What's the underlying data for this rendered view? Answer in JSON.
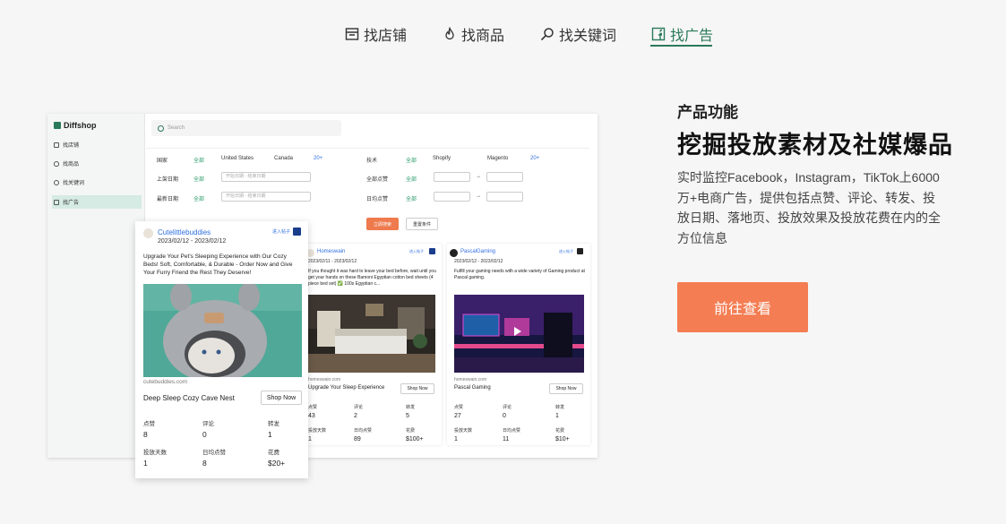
{
  "tabs": [
    {
      "label": "找店铺",
      "icon": "store-icon",
      "active": false
    },
    {
      "label": "找商品",
      "icon": "flame-icon",
      "active": false
    },
    {
      "label": "找关键词",
      "icon": "search-icon",
      "active": false
    },
    {
      "label": "找广告",
      "icon": "facebook-icon",
      "active": true
    }
  ],
  "feature": {
    "label": "产品功能",
    "headline": "挖掘投放素材及社媒爆品",
    "body": "实时监控Facebook，Instagram，TikTok上6000万+电商广告，提供包括点赞、评论、转发、投放日期、落地页、投放效果及投放花费在内的全方位信息",
    "cta": "前往查看"
  },
  "mock": {
    "logo": "Diffshop",
    "sidebar": [
      "找店铺",
      "找商品",
      "找关键词",
      "找广告"
    ],
    "search_placeholder": "Search",
    "filters": {
      "country": "国家",
      "all": "全部",
      "us": "United States",
      "canada": "Canada",
      "more": "20+",
      "tech": "技术",
      "shopify": "Shopify",
      "magento": "Magento",
      "launch_date": "上架日期",
      "latest_date": "最新日期",
      "date_placeholder": "开始日期 - 结束日期",
      "total_likes": "全部点赞",
      "daily_likes": "日均点赞",
      "arrow": "→"
    },
    "search_button": "立即搜索",
    "reset_button": "重置条件",
    "cards": [
      {
        "name": "Cutelittlebuddies",
        "date": "2023/02/12 - 2023/02/12",
        "enter": "进入帖子",
        "desc": "Upgrade Your Pet's Sleeping Experience with Our Cozy Beds! Soft, Comfortable, & Durable - Order Now and Give Your Furry Friend the Rest They Deserve!",
        "domain": "cutebuddies.com",
        "title": "Deep Sleep Cozy Cave Nest",
        "shop": "Shop Now",
        "stats": {
          "likes": "点赞",
          "comments": "评论",
          "shares": "转发",
          "days": "投放天数",
          "daily": "日均点赞",
          "spend": "花费"
        },
        "values": {
          "likes": "8",
          "comments": "0",
          "shares": "1",
          "days": "1",
          "daily": "8",
          "spend": "$20+"
        }
      },
      {
        "name": "Homeswain",
        "date": "2023/02/11 - 2023/02/12",
        "enter": "进入帖子",
        "desc": "If you thought it was hard to leave your bed before, wait until you get your hands on these Bamoni Egyptian cotton bed sheets (4 piece bed set) ✅ 100s Egyptian c...",
        "domain": "homeswain.com",
        "title": "Upgrade Your Sleep Experience",
        "shop": "Shop Now",
        "stats": {
          "likes": "点赞",
          "comments": "评论",
          "shares": "转发",
          "days": "投放天数",
          "daily": "日均点赞",
          "spend": "花费"
        },
        "values": {
          "likes": "43",
          "comments": "2",
          "shares": "5",
          "days": "1",
          "daily": "89",
          "spend": "$100+"
        }
      },
      {
        "name": "PascalGaming",
        "date": "2023/02/12 - 2023/02/12",
        "enter": "进入帖子",
        "desc": "Fulfill your gaming needs with a wide variety of Gaming product at Pascal gaming.",
        "domain": "homeswain.com",
        "title": "Pascal Gaming",
        "shop": "Shop Now",
        "stats": {
          "likes": "点赞",
          "comments": "评论",
          "shares": "转发",
          "days": "投放天数",
          "daily": "日均点赞",
          "spend": "花费"
        },
        "values": {
          "likes": "27",
          "comments": "0",
          "shares": "1",
          "days": "1",
          "daily": "11",
          "spend": "$10+"
        }
      }
    ]
  },
  "colors": {
    "accent": "#2a7a5a",
    "cta": "#f47d53",
    "link": "#2f6fe0"
  }
}
